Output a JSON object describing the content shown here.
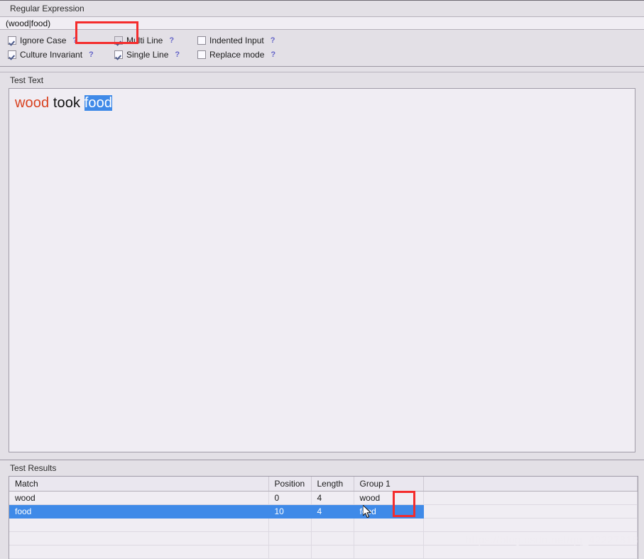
{
  "regex_section": {
    "label": "Regular Expression",
    "pattern": "(wood|food)",
    "placeholder": "Regular Expression",
    "help_glyph": "?"
  },
  "options": {
    "row1": [
      {
        "label": "Ignore Case",
        "checked": true,
        "dimmed": false,
        "help": "?"
      },
      {
        "label": "Multi Line",
        "checked": true,
        "dimmed": true,
        "help": "?"
      },
      {
        "label": "Indented Input",
        "checked": false,
        "dimmed": false,
        "help": "?"
      }
    ],
    "row2": [
      {
        "label": "Culture Invariant",
        "checked": true,
        "dimmed": false,
        "help": "?"
      },
      {
        "label": "Single Line",
        "checked": true,
        "dimmed": false,
        "help": "?"
      },
      {
        "label": "Replace mode",
        "checked": false,
        "dimmed": false,
        "help": "?"
      }
    ]
  },
  "test_text": {
    "label": "Test Text",
    "tokens": [
      {
        "text": "wood",
        "style": "match"
      },
      {
        "text": " took ",
        "style": "plain"
      },
      {
        "text": "food",
        "style": "selected"
      }
    ],
    "full_text": "wood took food"
  },
  "results": {
    "label": "Test Results",
    "columns": [
      "Match",
      "Position",
      "Length",
      "Group 1",
      ""
    ],
    "rows": [
      {
        "match": "wood",
        "position": "0",
        "length": "4",
        "group1": "wood",
        "selected": false
      },
      {
        "match": "food",
        "position": "10",
        "length": "4",
        "group1": "food",
        "selected": true
      }
    ],
    "empty_row_count": 3
  },
  "colors": {
    "accent_selection": "#3f8ae8",
    "match_text": "#d8411f",
    "annotation": "#f42c2c",
    "help_link": "#6464c8",
    "panel_bg": "#e3e0e6",
    "field_bg": "#f0edf3"
  },
  "watermark": {
    "text": "https://blog.csdn.net/qq_42227818"
  }
}
